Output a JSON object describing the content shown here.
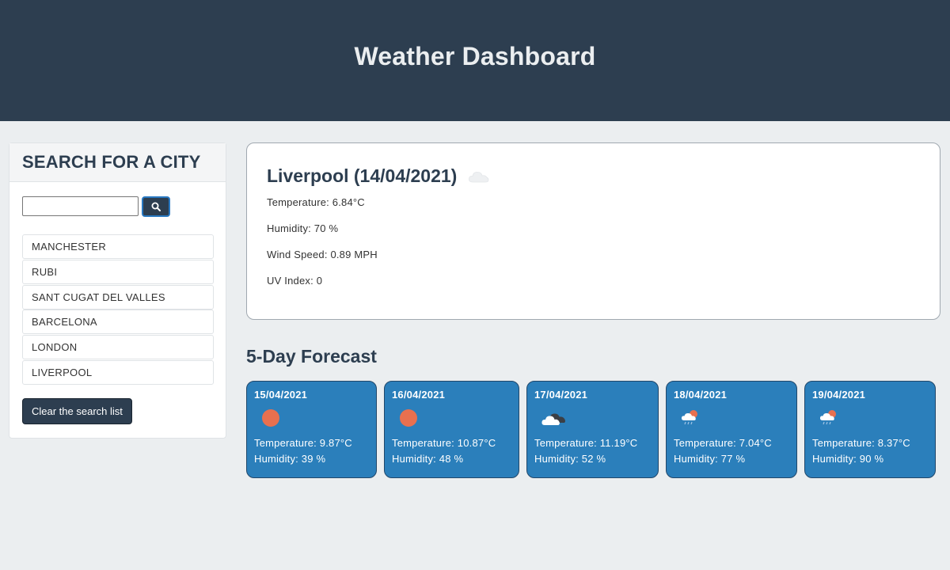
{
  "header": {
    "title": "Weather Dashboard"
  },
  "sidebar": {
    "heading": "SEARCH FOR A CITY",
    "search": {
      "value": "",
      "placeholder": ""
    },
    "search_icon": "search-icon",
    "cities": [
      "MANCHESTER",
      "RUBI",
      "SANT CUGAT DEL VALLES",
      "BARCELONA",
      "LONDON",
      "LIVERPOOL"
    ],
    "clear_label": "Clear the search list"
  },
  "current": {
    "title": "Liverpool (14/04/2021)",
    "icon": "cloud-icon",
    "temperature": "Temperature: 6.84°C",
    "humidity": "Humidity: 70 %",
    "wind": "Wind Speed: 0.89 MPH",
    "uv": "UV Index: 0"
  },
  "forecast": {
    "title": "5-Day Forecast",
    "days": [
      {
        "date": "15/04/2021",
        "icon": "sun-icon",
        "temp": "Temperature: 9.87°C",
        "hum": "Humidity: 39 %"
      },
      {
        "date": "16/04/2021",
        "icon": "sun-icon",
        "temp": "Temperature: 10.87°C",
        "hum": "Humidity: 48 %"
      },
      {
        "date": "17/04/2021",
        "icon": "clouds-icon",
        "temp": "Temperature: 11.19°C",
        "hum": "Humidity: 52 %"
      },
      {
        "date": "18/04/2021",
        "icon": "rain-sun-icon",
        "temp": "Temperature: 7.04°C",
        "hum": "Humidity: 77 %"
      },
      {
        "date": "19/04/2021",
        "icon": "rain-sun-icon",
        "temp": "Temperature: 8.37°C",
        "hum": "Humidity: 90 %"
      }
    ]
  },
  "colors": {
    "header_bg": "#2d3e50",
    "page_bg": "#ebeef0",
    "card_bg": "#2b7fbb",
    "sun": "#e8704f"
  }
}
